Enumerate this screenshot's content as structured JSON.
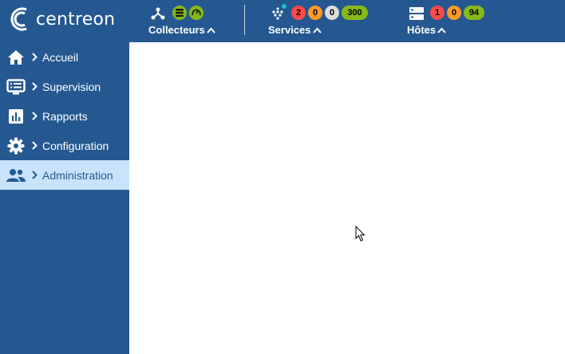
{
  "app": {
    "logo_text": "centreon"
  },
  "topbar": {
    "pollers": {
      "label": "Collecteurs"
    },
    "services": {
      "label": "Services",
      "critical": "2",
      "warning": "0",
      "unknown": "0",
      "ok": "300"
    },
    "hosts": {
      "label": "Hôtes",
      "down": "1",
      "unreachable": "0",
      "up": "94"
    }
  },
  "sidebar": {
    "items": [
      {
        "label": "Accueil",
        "icon": "home-icon"
      },
      {
        "label": "Supervision",
        "icon": "monitor-icon"
      },
      {
        "label": "Rapports",
        "icon": "bar-chart-icon"
      },
      {
        "label": "Configuration",
        "icon": "gear-icon"
      },
      {
        "label": "Administration",
        "icon": "users-icon",
        "active": true
      }
    ]
  },
  "colors": {
    "primary": "#255891",
    "active_bg": "#c9e3fb",
    "status_critical": "#ff4a4a",
    "status_warning": "#fd9b27",
    "status_unknown": "#dcdcdc",
    "status_ok": "#88b917"
  }
}
